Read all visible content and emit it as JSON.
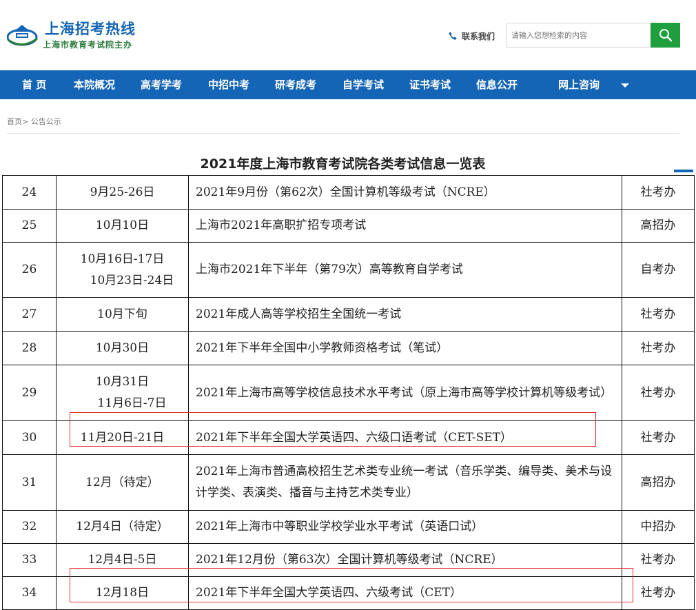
{
  "header": {
    "site_title": "上海招考热线",
    "site_subtitle": "上海市教育考试院主办",
    "contact_label": "联系我们",
    "search_placeholder": "请输入您想检索的内容"
  },
  "nav": {
    "items": [
      "首 页",
      "本院概况",
      "高考学考",
      "中招中考",
      "研考成考",
      "自学考试",
      "证书考试",
      "信息公开",
      "网上咨询"
    ]
  },
  "breadcrumb": {
    "home": "首页",
    "separator": ">",
    "current": "公告公示"
  },
  "page_title": "2021年度上海市教育考试院各类考试信息一览表",
  "table": {
    "rows": [
      {
        "no": "24",
        "date": [
          "9月25-26日"
        ],
        "name": "2021年9月份（第62次）全国计算机等级考试（NCRE）",
        "dept": "社考办"
      },
      {
        "no": "25",
        "date": [
          "10月10日"
        ],
        "name": "上海市2021年高职扩招专项考试",
        "dept": "高招办"
      },
      {
        "no": "26",
        "date": [
          "10月16日-17日",
          "10月23日-24日"
        ],
        "name": "上海市2021年下半年（第79次）高等教育自学考试",
        "dept": "自考办"
      },
      {
        "no": "27",
        "date": [
          "10月下旬"
        ],
        "name": "2021年成人高等学校招生全国统一考试",
        "dept": "社考办"
      },
      {
        "no": "28",
        "date": [
          "10月30日"
        ],
        "name": "2021年下半年全国中小学教师资格考试（笔试）",
        "dept": "社考办"
      },
      {
        "no": "29",
        "date": [
          "10月31日",
          "11月6日-7日"
        ],
        "name": "2021年上海市高等学校信息技术水平考试（原上海市高等学校计算机等级考试）",
        "dept": "社考办"
      },
      {
        "no": "30",
        "date": [
          "11月20日-21日"
        ],
        "name": "2021年下半年全国大学英语四、六级口语考试（CET-SET）",
        "dept": "社考办"
      },
      {
        "no": "31",
        "date": [
          "12月（待定）"
        ],
        "name": "2021年上海市普通高校招生艺术类专业统一考试（音乐学类、编导类、美术与设计学类、表演类、播音与主持艺术类专业）",
        "dept": "高招办"
      },
      {
        "no": "32",
        "date": [
          "12月4日（待定）"
        ],
        "name": "2021年上海市中等职业学校学业水平考试（英语口试）",
        "dept": "中招办"
      },
      {
        "no": "33",
        "date": [
          "12月4日-5日"
        ],
        "name": "2021年12月份（第63次）全国计算机等级考试（NCRE）",
        "dept": "社考办"
      },
      {
        "no": "34",
        "date": [
          "12月18日"
        ],
        "name": "2021年下半年全国大学英语四、六级考试（CET）",
        "dept": "社考办"
      }
    ]
  },
  "colors": {
    "brand_blue": "#1565b6",
    "search_green": "#1e9e3c",
    "highlight_red": "#e32b2b"
  },
  "icons": {
    "logo": "smeea-logo-icon",
    "phone": "phone-icon",
    "search": "search-icon",
    "nav_more": "caret-down-icon"
  }
}
